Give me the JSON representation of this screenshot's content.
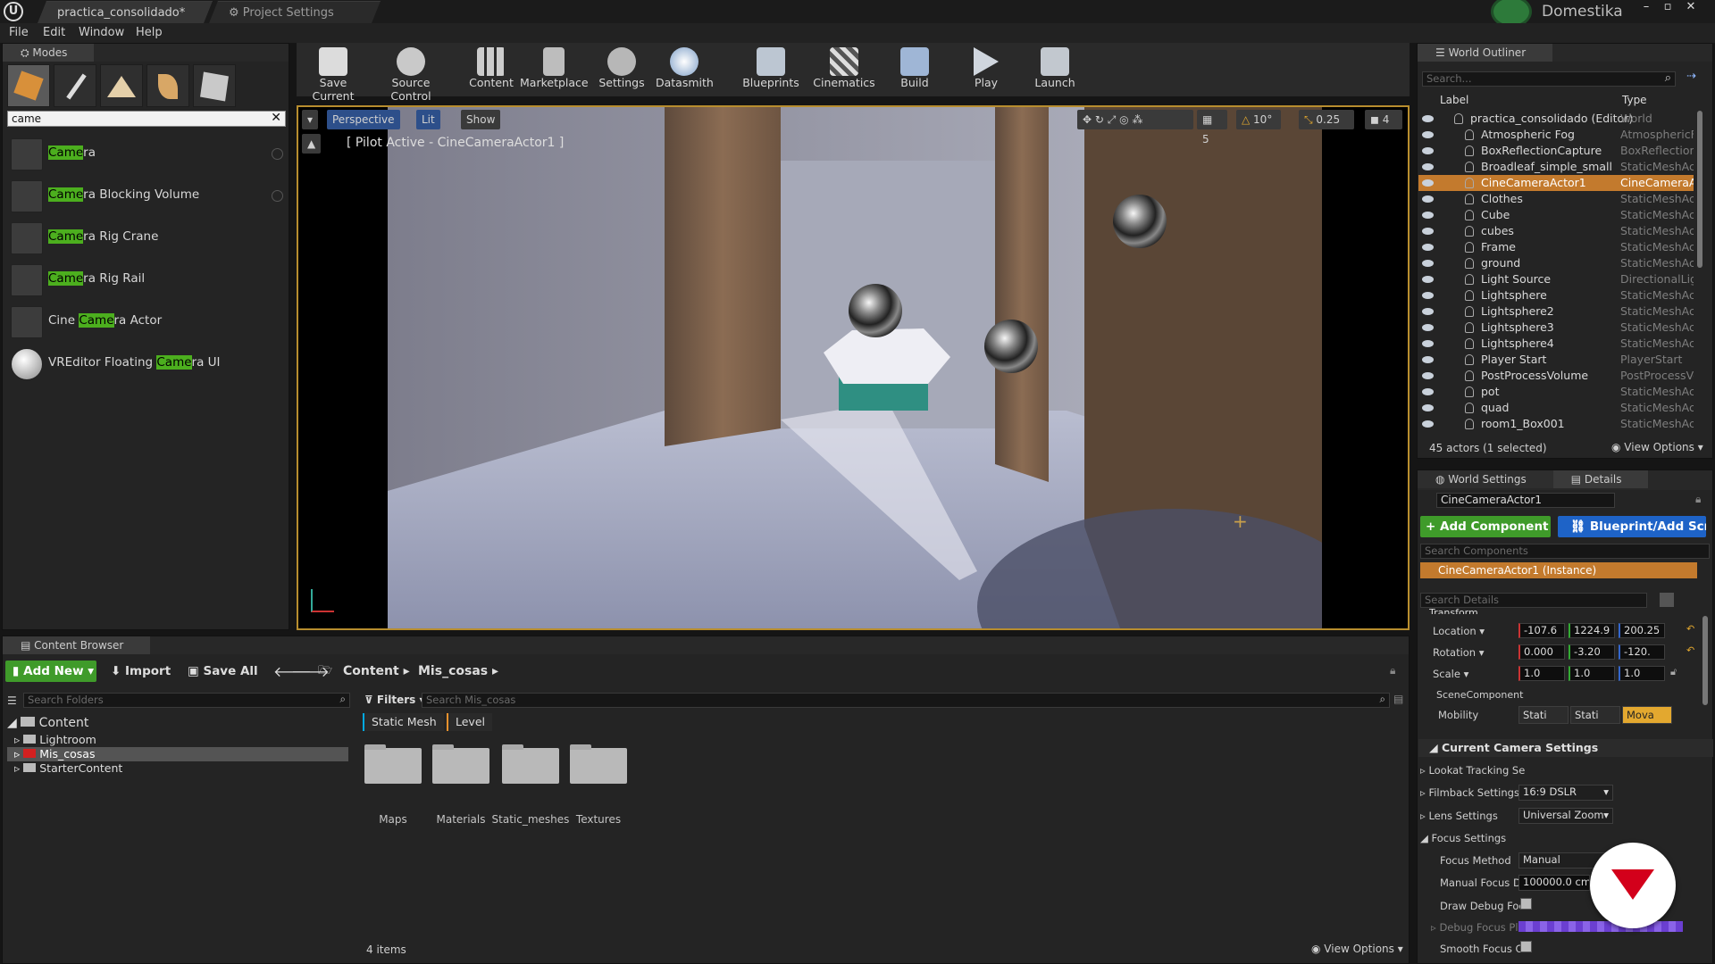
{
  "titlebar": {
    "tabs": [
      "practica_consolidado*",
      "Project Settings"
    ],
    "brand": "Domestika"
  },
  "menu": [
    "File",
    "Edit",
    "Window",
    "Help"
  ],
  "modes": {
    "title": "Modes",
    "search_value": "came",
    "items": [
      {
        "pre": "",
        "hl": "Came",
        "post": "ra"
      },
      {
        "pre": "",
        "hl": "Came",
        "post": "ra Blocking Volume"
      },
      {
        "pre": "",
        "hl": "Came",
        "post": "ra Rig Crane"
      },
      {
        "pre": "",
        "hl": "Came",
        "post": "ra Rig Rail"
      },
      {
        "pre": "Cine ",
        "hl": "Came",
        "post": "ra Actor"
      },
      {
        "pre": "VREditor Floating ",
        "hl": "Came",
        "post": "ra UI"
      }
    ]
  },
  "toolbar": [
    "Save Current",
    "Source Control",
    "Content",
    "Marketplace",
    "Settings",
    "Datasmith",
    "Blueprints",
    "Cinematics",
    "Build",
    "Play",
    "Launch"
  ],
  "viewport": {
    "perspective": "Perspective",
    "lit": "Lit",
    "show": "Show",
    "pilot": "[ Pilot Active - CineCameraActor1 ]",
    "grid": "5",
    "angle": "10°",
    "scale": "0.25",
    "cam_speed": "4"
  },
  "outliner": {
    "title": "World Outliner",
    "search_placeholder": "Search...",
    "col_label": "Label",
    "col_type": "Type",
    "rows": [
      {
        "name": "practica_consolidado (Editor)",
        "type": "World"
      },
      {
        "name": "Atmospheric Fog",
        "type": "AtmosphericFo"
      },
      {
        "name": "BoxReflectionCapture",
        "type": "BoxReflectionC"
      },
      {
        "name": "Broadleaf_simple_small",
        "type": "StaticMeshActo"
      },
      {
        "name": "CineCameraActor1",
        "type": "CineCameraAc"
      },
      {
        "name": "Clothes",
        "type": "StaticMeshActo"
      },
      {
        "name": "Cube",
        "type": "StaticMeshActo"
      },
      {
        "name": "cubes",
        "type": "StaticMeshActo"
      },
      {
        "name": "Frame",
        "type": "StaticMeshActo"
      },
      {
        "name": "ground",
        "type": "StaticMeshActo"
      },
      {
        "name": "Light Source",
        "type": "DirectionalLigh"
      },
      {
        "name": "Lightsphere",
        "type": "StaticMeshActo"
      },
      {
        "name": "Lightsphere2",
        "type": "StaticMeshActo"
      },
      {
        "name": "Lightsphere3",
        "type": "StaticMeshActo"
      },
      {
        "name": "Lightsphere4",
        "type": "StaticMeshActo"
      },
      {
        "name": "Player Start",
        "type": "PlayerStart"
      },
      {
        "name": "PostProcessVolume",
        "type": "PostProcessVo"
      },
      {
        "name": "pot",
        "type": "StaticMeshActo"
      },
      {
        "name": "quad",
        "type": "StaticMeshActo"
      },
      {
        "name": "room1_Box001",
        "type": "StaticMeshActo"
      }
    ],
    "count": "45 actors (1 selected)",
    "view_options": "View Options"
  },
  "details": {
    "tab_world": "World Settings",
    "tab_details": "Details",
    "actor_name": "CineCameraActor1",
    "add_component": "+ Add Component",
    "blueprint": "Blueprint/Add Scri",
    "search_components": "Search Components",
    "instance": "CineCameraActor1 (Instance)",
    "search_details": "Search Details",
    "transform": "Transform",
    "location_label": "Location",
    "rotation_label": "Rotation",
    "scale_label": "Scale",
    "location": [
      "-107.6",
      "1224.9",
      "200.25"
    ],
    "rotation": [
      "0.000",
      "-3.20",
      "-120."
    ],
    "scale": [
      "1.0",
      "1.0",
      "1.0"
    ],
    "scene_component": "SceneComponent",
    "mobility_label": "Mobility",
    "mobility": [
      "Stati",
      "Stati",
      "Mova"
    ],
    "current_camera": "Current Camera Settings",
    "lookat": "Lookat Tracking Se",
    "filmback_label": "Filmback Settings",
    "filmback_value": "16:9 DSLR",
    "lens_label": "Lens Settings",
    "lens_value": "Universal Zoom",
    "focus_settings": "Focus Settings",
    "focus_method_label": "Focus Method",
    "focus_method_value": "Manual",
    "manual_focus_label": "Manual Focus Di",
    "manual_focus_value": "100000.0 cm",
    "draw_debug_label": "Draw Debug Focu",
    "debug_plane_label": "Debug Focus Pla",
    "smooth_label": "Smooth Focus Ch"
  },
  "content_browser": {
    "title": "Content Browser",
    "add_new": "Add New",
    "import": "Import",
    "save_all": "Save All",
    "path": [
      "Content",
      "Mis_cosas"
    ],
    "search_folders": "Search Folders",
    "filters": "Filters",
    "search_assets": "Search Mis_cosas",
    "filter_chips": [
      "Static Mesh",
      "Level"
    ],
    "tree": [
      {
        "name": "Content",
        "level": 0
      },
      {
        "name": "Lightroom",
        "level": 1
      },
      {
        "name": "Mis_cosas",
        "level": 1
      },
      {
        "name": "StarterContent",
        "level": 1
      }
    ],
    "folders": [
      "Maps",
      "Materials",
      "Static_meshes",
      "Textures"
    ],
    "items_count": "4 items",
    "view_options": "View Options"
  },
  "colors": {
    "accent_orange": "#c37a2d",
    "accent_green": "#4caf1e",
    "accent_blue": "#1e63c7",
    "brand_red": "#d3001b"
  }
}
